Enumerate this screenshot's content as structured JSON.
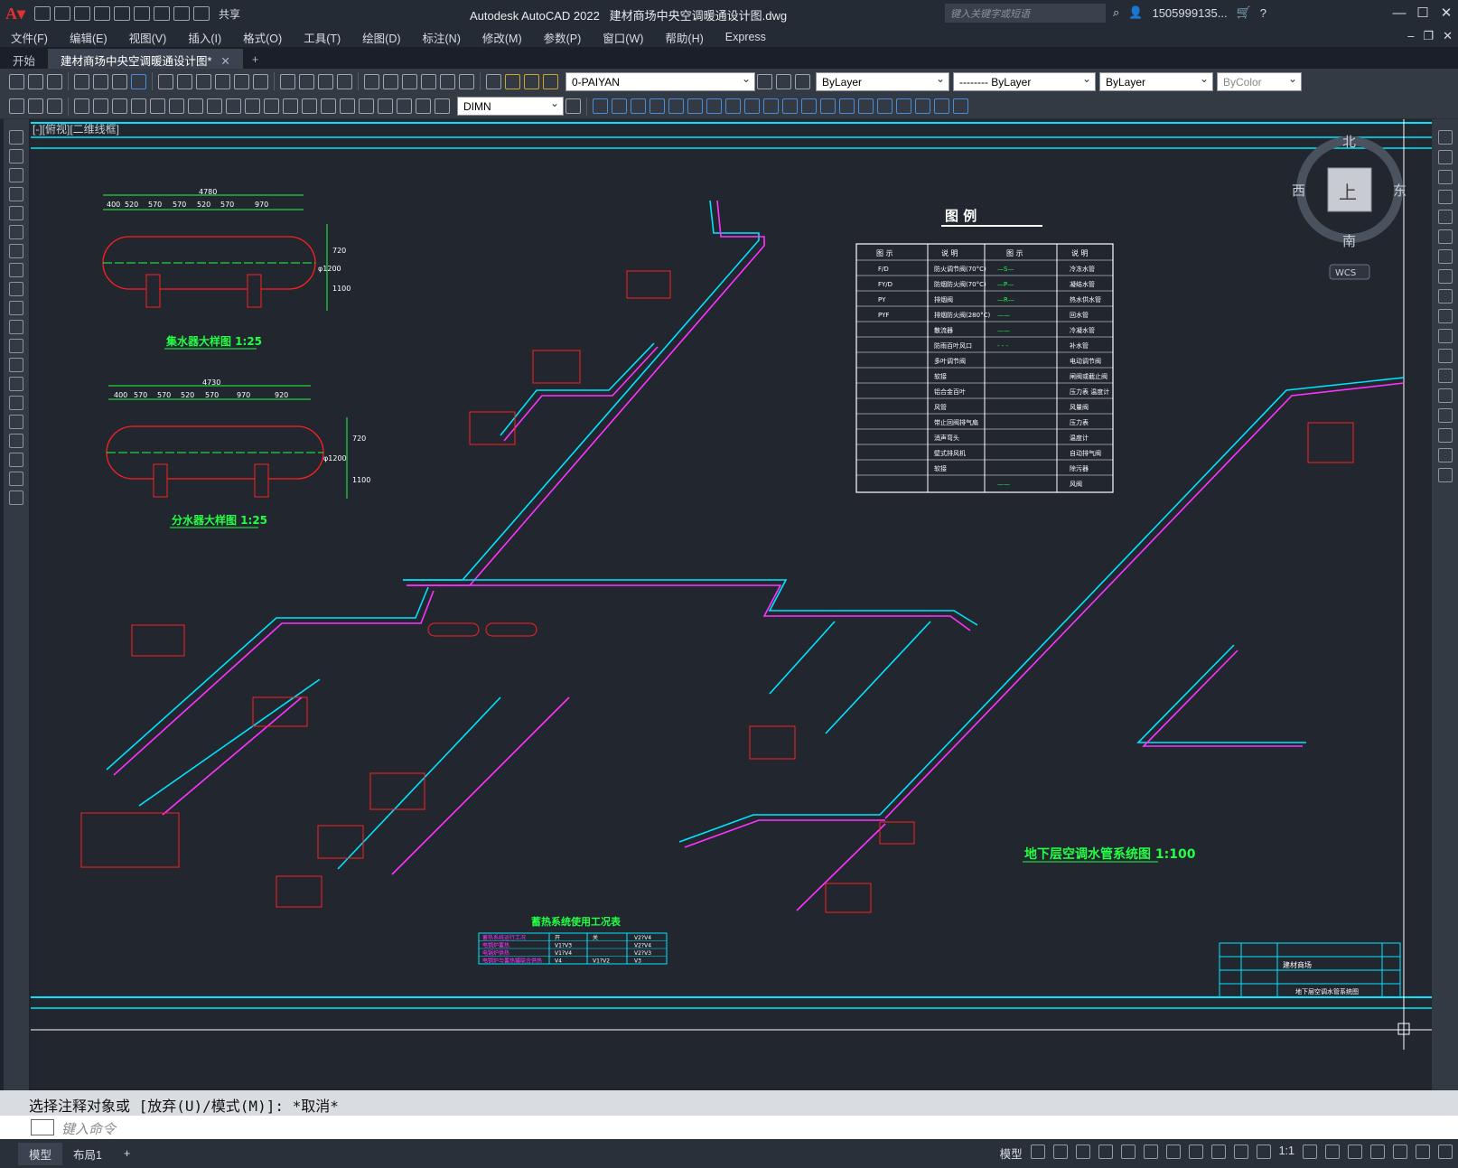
{
  "app": {
    "title": "Autodesk AutoCAD 2022",
    "filename": "建材商场中央空调暖通设计图.dwg",
    "share": "共享",
    "search_placeholder": "键入关键字或短语",
    "user": "1505999135..."
  },
  "menu": [
    "文件(F)",
    "编辑(E)",
    "视图(V)",
    "插入(I)",
    "格式(O)",
    "工具(T)",
    "绘图(D)",
    "标注(N)",
    "修改(M)",
    "参数(P)",
    "窗口(W)",
    "帮助(H)",
    "Express"
  ],
  "tabs": [
    {
      "label": "开始",
      "active": false
    },
    {
      "label": "建材商场中央空调暖通设计图*",
      "active": true
    }
  ],
  "toolbar": {
    "layer": "0-PAIYAN",
    "color": "ByLayer",
    "linetype": "-------- ByLayer",
    "lineweight": "ByLayer",
    "plotstyle": "ByColor",
    "dimstyle": "DIMN"
  },
  "viewport": {
    "label": "[-][俯视][二维线框]",
    "viewcube": {
      "north": "北",
      "south": "南",
      "east": "东",
      "west": "西",
      "face": "上",
      "wcs": "WCS"
    }
  },
  "drawing": {
    "collector_title": "集水器大样图 1:25",
    "distributor_title": "分水器大样图 1:25",
    "collector_dims": [
      "4780",
      "400",
      "520",
      "570",
      "570",
      "520",
      "570",
      "970"
    ],
    "distributor_dims": [
      "4730",
      "400",
      "570",
      "570",
      "520",
      "570",
      "970",
      "920"
    ],
    "vessel_side_dims": [
      "720",
      "φ1200",
      "1100"
    ],
    "legend_title": "图    例",
    "legend_headers": [
      "图 示",
      "说 明",
      "图 示",
      "说 明"
    ],
    "legend_rows": [
      [
        "F/D",
        "防火调节阀(70°C)",
        "—S—",
        "冷冻水管"
      ],
      [
        "FY/D",
        "防烟防火阀(70°C)",
        "—P—",
        "凝结水管"
      ],
      [
        "PY",
        "排烟阀",
        "—R—",
        "热水供水管"
      ],
      [
        "PYF",
        "排烟防火阀(280°C)",
        "——",
        "回水管"
      ],
      [
        "",
        "散流器",
        "——",
        "冷凝水管"
      ],
      [
        "",
        "防雨百叶风口",
        "- - -",
        "补水管"
      ],
      [
        "",
        "多叶调节阀",
        "",
        "电动调节阀"
      ],
      [
        "",
        "软接",
        "",
        "闸阀或截止阀"
      ],
      [
        "",
        "铝合金百叶",
        "",
        "压力表 温度计"
      ],
      [
        "",
        "风管",
        "",
        "风量阀"
      ],
      [
        "",
        "带止回阀排气扇",
        "",
        "压力表"
      ],
      [
        "",
        "消声弯头",
        "",
        "温度计"
      ],
      [
        "",
        "壁式排风机",
        "",
        "自动排气阀"
      ],
      [
        "",
        "软接",
        "",
        "除污器"
      ],
      [
        "",
        "",
        "——",
        "风阀"
      ]
    ],
    "system_title": "地下层空调水管系统图 1:100",
    "usage_title": "蓄热系统使用工况表",
    "usage_rows": [
      [
        "蓄热系统运行工况",
        "开",
        "关",
        "V2?V4"
      ],
      [
        "电锅炉蓄热",
        "V1?V3",
        "",
        "V2?V4"
      ],
      [
        "电锅炉供热",
        "V1?V4",
        "",
        "V2?V3"
      ],
      [
        "电锅炉与蓄热罐联合供热",
        "V4",
        "V1?V2",
        "V3"
      ]
    ],
    "titleblock": {
      "project": "建材商场",
      "drawing": "地下层空调水管系统图"
    }
  },
  "command": {
    "history": "选择注释对象或 [放弃(U)/模式(M)]: *取消*",
    "placeholder": "键入命令"
  },
  "status": {
    "tabs": [
      "模型",
      "布局1"
    ],
    "model_label": "模型",
    "scale": "1:1"
  },
  "colors": {
    "cyan": "#00e5ff",
    "magenta": "#ff33ff",
    "red": "#ff2020",
    "green": "#22ff44",
    "white": "#ffffff",
    "bg": "#21262f"
  }
}
